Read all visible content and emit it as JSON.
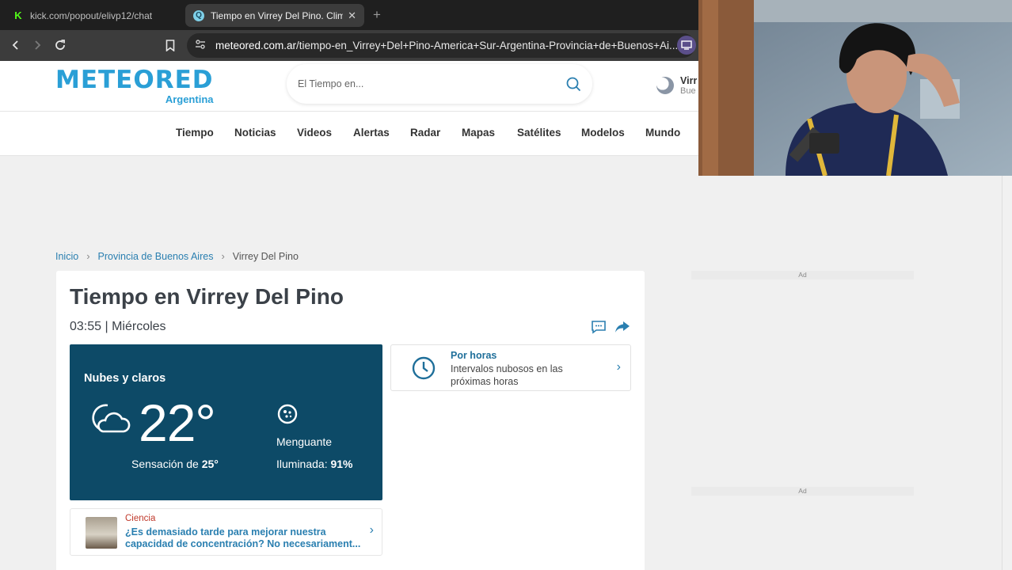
{
  "browser": {
    "tabs": [
      {
        "label": "kick.com/popout/elivp12/chat",
        "active": false,
        "favicon": "K"
      },
      {
        "label": "Tiempo en Virrey Del Pino. Clima",
        "active": true,
        "favicon": "Q"
      }
    ],
    "new_tab_icon": "+",
    "close_icon": "✕",
    "url_domain": "meteored.com.ar",
    "url_path": "/tiempo-en_Virrey+Del+Pino-America+Sur-Argentina-Provincia+de+Buenos+Ai..."
  },
  "site": {
    "logo": "METEORED",
    "logo_country": "Argentina",
    "search_placeholder": "El Tiempo en...",
    "location_name": "Virr",
    "location_sub": "Bue",
    "brand_color": "#2a9fd6"
  },
  "nav": [
    "Tiempo",
    "Noticias",
    "Videos",
    "Alertas",
    "Radar",
    "Mapas",
    "Satélites",
    "Modelos",
    "Mundo"
  ],
  "breadcrumb": [
    "Inicio",
    "Provincia de Buenos Aires",
    "Virrey Del Pino"
  ],
  "weather": {
    "title": "Tiempo en Virrey Del Pino",
    "time": "03:55 | Miércoles",
    "condition": "Nubes y claros",
    "temperature": "22°",
    "feels_label": "Sensación de ",
    "feels_value": "25°",
    "moon_phase": "Menguante",
    "illuminated_label": "Iluminada: ",
    "illuminated_value": "91%",
    "panel_color": "#0d4a67"
  },
  "hourly": {
    "title": "Por horas",
    "description": "Intervalos nubosos en las próximas horas"
  },
  "news": {
    "category": "Ciencia",
    "title": "¿Es demasiado tarde para mejorar nuestra capacidad de concentración? No necesariament..."
  },
  "ads": [
    "Ad",
    "Ad"
  ]
}
